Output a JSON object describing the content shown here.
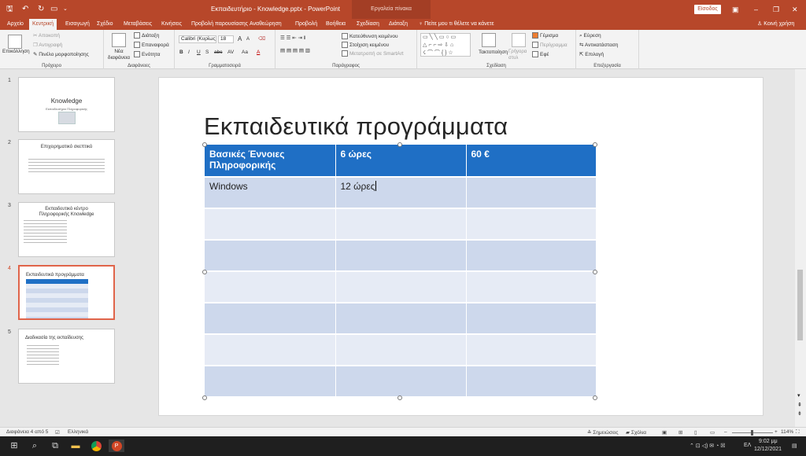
{
  "titlebar": {
    "document_title": "Εκπαιδευτήριο - Knowledge.pptx - PowerPoint",
    "context_group": "Εργαλεία πίνακα",
    "signin": "Είσοδος",
    "win_buttons": [
      "▣",
      "–",
      "❐",
      "✕"
    ]
  },
  "tabs": [
    "Αρχείο",
    "Κεντρική",
    "Εισαγωγή",
    "Σχέδιο",
    "Μεταβάσεις",
    "Κινήσεις",
    "Προβολή παρουσίασης",
    "Αναθεώρηση",
    "Προβολή",
    "Βοήθεια",
    "Σχεδίαση",
    "Διάταξη"
  ],
  "tell_me": "Πείτε μου τι θέλετε να κάνετε",
  "share": "Κοινή χρήση",
  "ribbon": {
    "clipboard": {
      "paste": "Επικόλληση",
      "cut": "Αποκοπή",
      "copy": "Αντιγραφή",
      "format_painter": "Πινέλο μορφοποίησης",
      "label": "Πρόχειρο"
    },
    "slides": {
      "new_slide": "Νέα διαφάνεια",
      "layout": "Διάταξη",
      "reset": "Επαναφορά",
      "section": "Ενότητα",
      "label": "Διαφάνειες"
    },
    "font": {
      "name": "Calibri (Κυρίως",
      "size": "18",
      "bold": "B",
      "italic": "I",
      "underline": "U",
      "shadow": "S",
      "strike": "abc",
      "spacing": "AV",
      "case": "Aa",
      "color": "A",
      "grow": "A",
      "shrink": "A",
      "label": "Γραμματοσειρά"
    },
    "paragraph": {
      "direction": "Κατεύθυνση κειμένου",
      "align": "Στοίχιση κειμένου",
      "smartart": "Μετατροπή σε SmartArt",
      "label": "Παράγραφος"
    },
    "drawing": {
      "arrange": "Τακτοποίηση",
      "quick_styles": "Γρήγορα στυλ",
      "fill": "Γέμισμα",
      "outline": "Περίγραμμα",
      "effects": "Εφέ",
      "label": "Σχεδίαση"
    },
    "editing": {
      "find": "Εύρεση",
      "replace": "Αντικατάσταση",
      "select": "Επιλογή",
      "label": "Επεξεργασία"
    }
  },
  "thumbnails": [
    {
      "num": "1",
      "title": "Knowledge",
      "subtitle": "Εκπαιδευτήριο Πληροφορικής"
    },
    {
      "num": "2",
      "title": "Επιχειρηματικό σκεπτικό"
    },
    {
      "num": "3",
      "title": "Εκπαιδευτικό κέντρο Πληροφορικής Knowledge"
    },
    {
      "num": "4",
      "title": "Εκπαιδευτικά προγράμματα"
    },
    {
      "num": "5",
      "title": "Διαδικασία της εκπαίδευσης"
    }
  ],
  "slide": {
    "title": "Εκπαιδευτικά προγράμματα",
    "table": {
      "header": [
        "Βασικές Έννοιες Πληροφορικής",
        "6 ώρες",
        "60 €"
      ],
      "row1": [
        "Windows",
        "12 ώρες",
        ""
      ]
    }
  },
  "status": {
    "slide_info": "Διαφάνεια 4 από 5",
    "language": "Ελληνικά",
    "notes": "Σημειώσεις",
    "comments": "Σχόλια",
    "zoom": "114%"
  },
  "taskbar": {
    "lang": "ΕΛ",
    "time": "9:02 μμ",
    "date": "12/12/2021"
  }
}
